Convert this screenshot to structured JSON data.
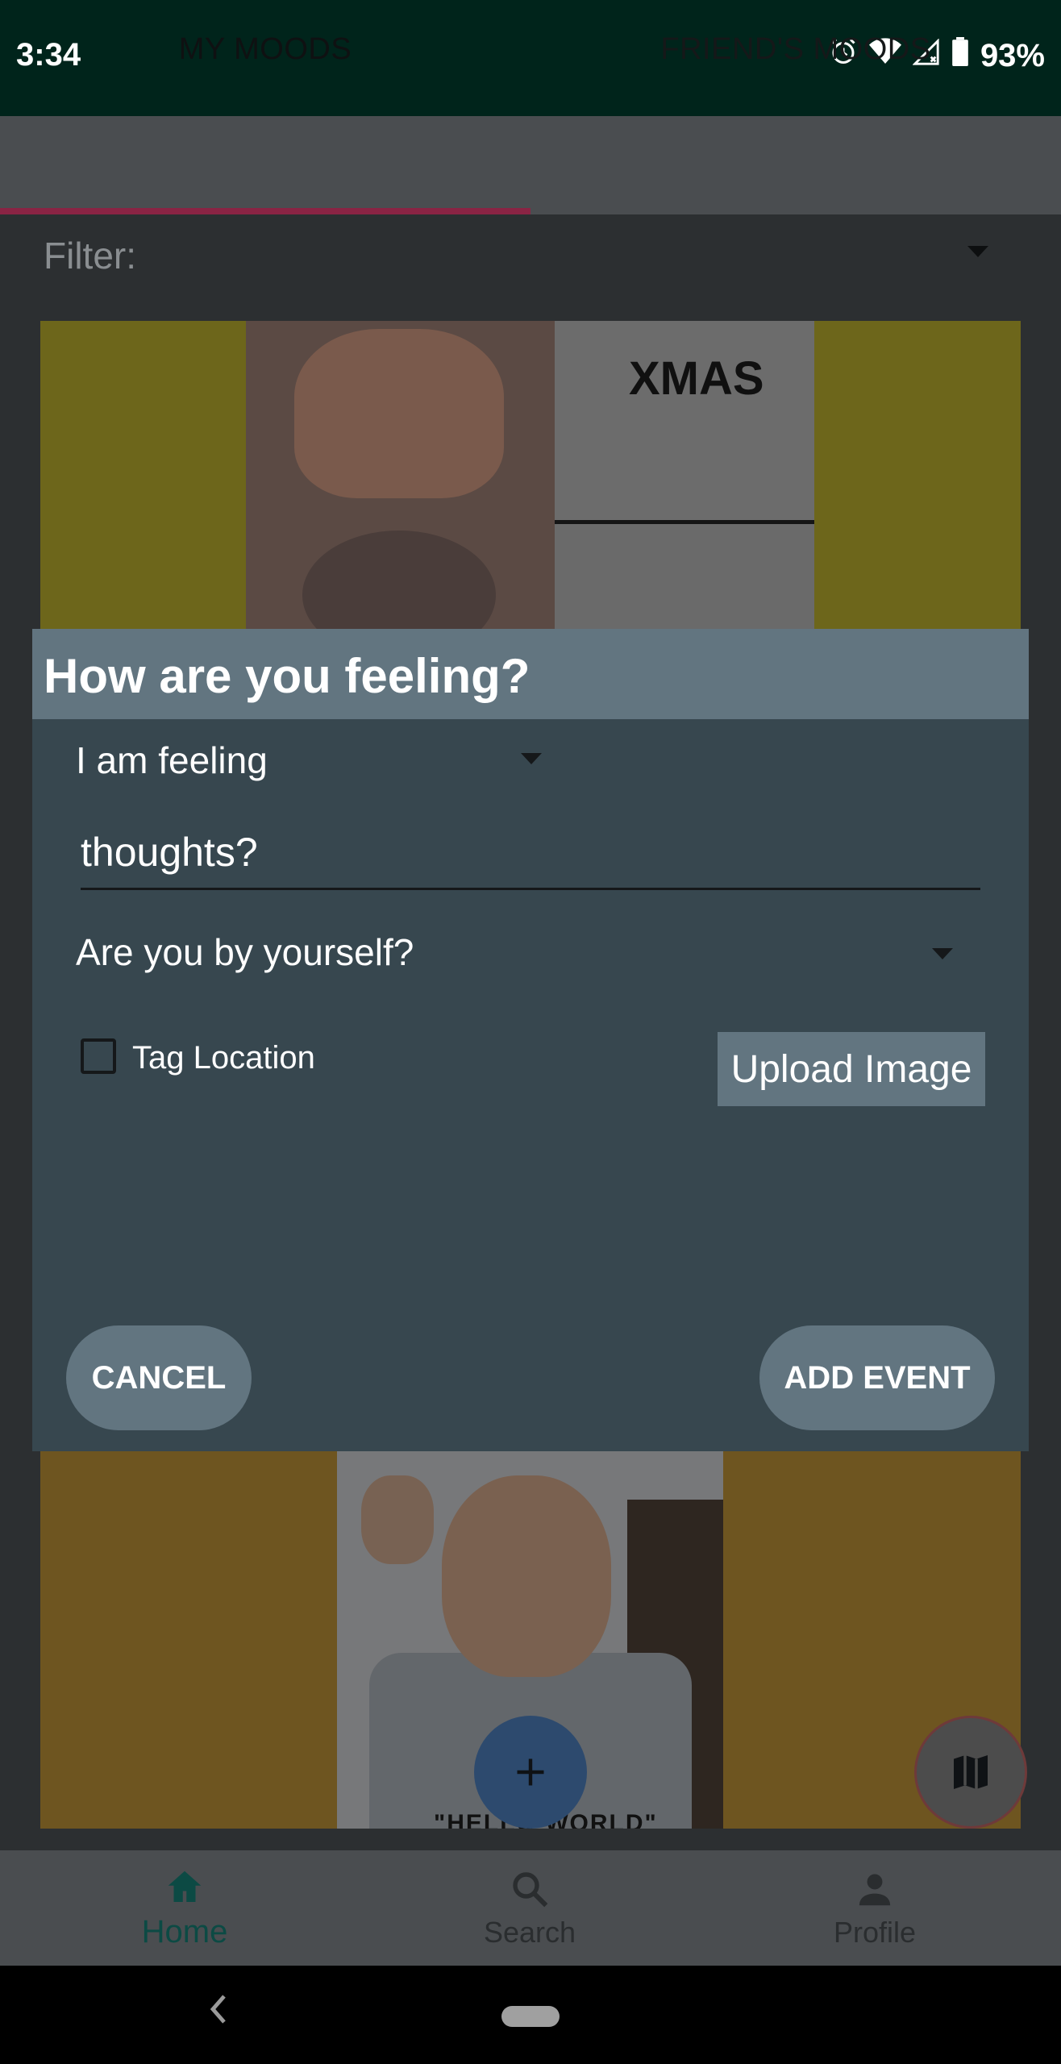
{
  "status_bar": {
    "time": "3:34",
    "battery": "93%"
  },
  "tabs": [
    {
      "label": "MY MOODS",
      "selected": true
    },
    {
      "label": "FRIEND'S MOODS",
      "selected": false
    }
  ],
  "filter": {
    "label": "Filter:"
  },
  "cards": {
    "top_caption": "XMAS",
    "bottom_caption": "\"HELLO WORLD\""
  },
  "dialog": {
    "title": "How are you feeling?",
    "feeling_label": "I am feeling",
    "thoughts_placeholder": "thoughts?",
    "alone_label": "Are you by yourself?",
    "tag_location_label": "Tag Location",
    "upload_label": "Upload Image",
    "cancel_label": "CANCEL",
    "add_label": "ADD EVENT"
  },
  "fab": {
    "add_symbol": "+"
  },
  "bottom_nav": [
    {
      "label": "Home",
      "icon": "home-icon",
      "selected": true
    },
    {
      "label": "Search",
      "icon": "search-icon",
      "selected": false
    },
    {
      "label": "Profile",
      "icon": "person-icon",
      "selected": false
    }
  ],
  "colors": {
    "dialog_bg": "#37474f",
    "dialog_accent": "#627580",
    "tab_indicator": "#8a2444",
    "nav_active": "#0c4a44"
  }
}
